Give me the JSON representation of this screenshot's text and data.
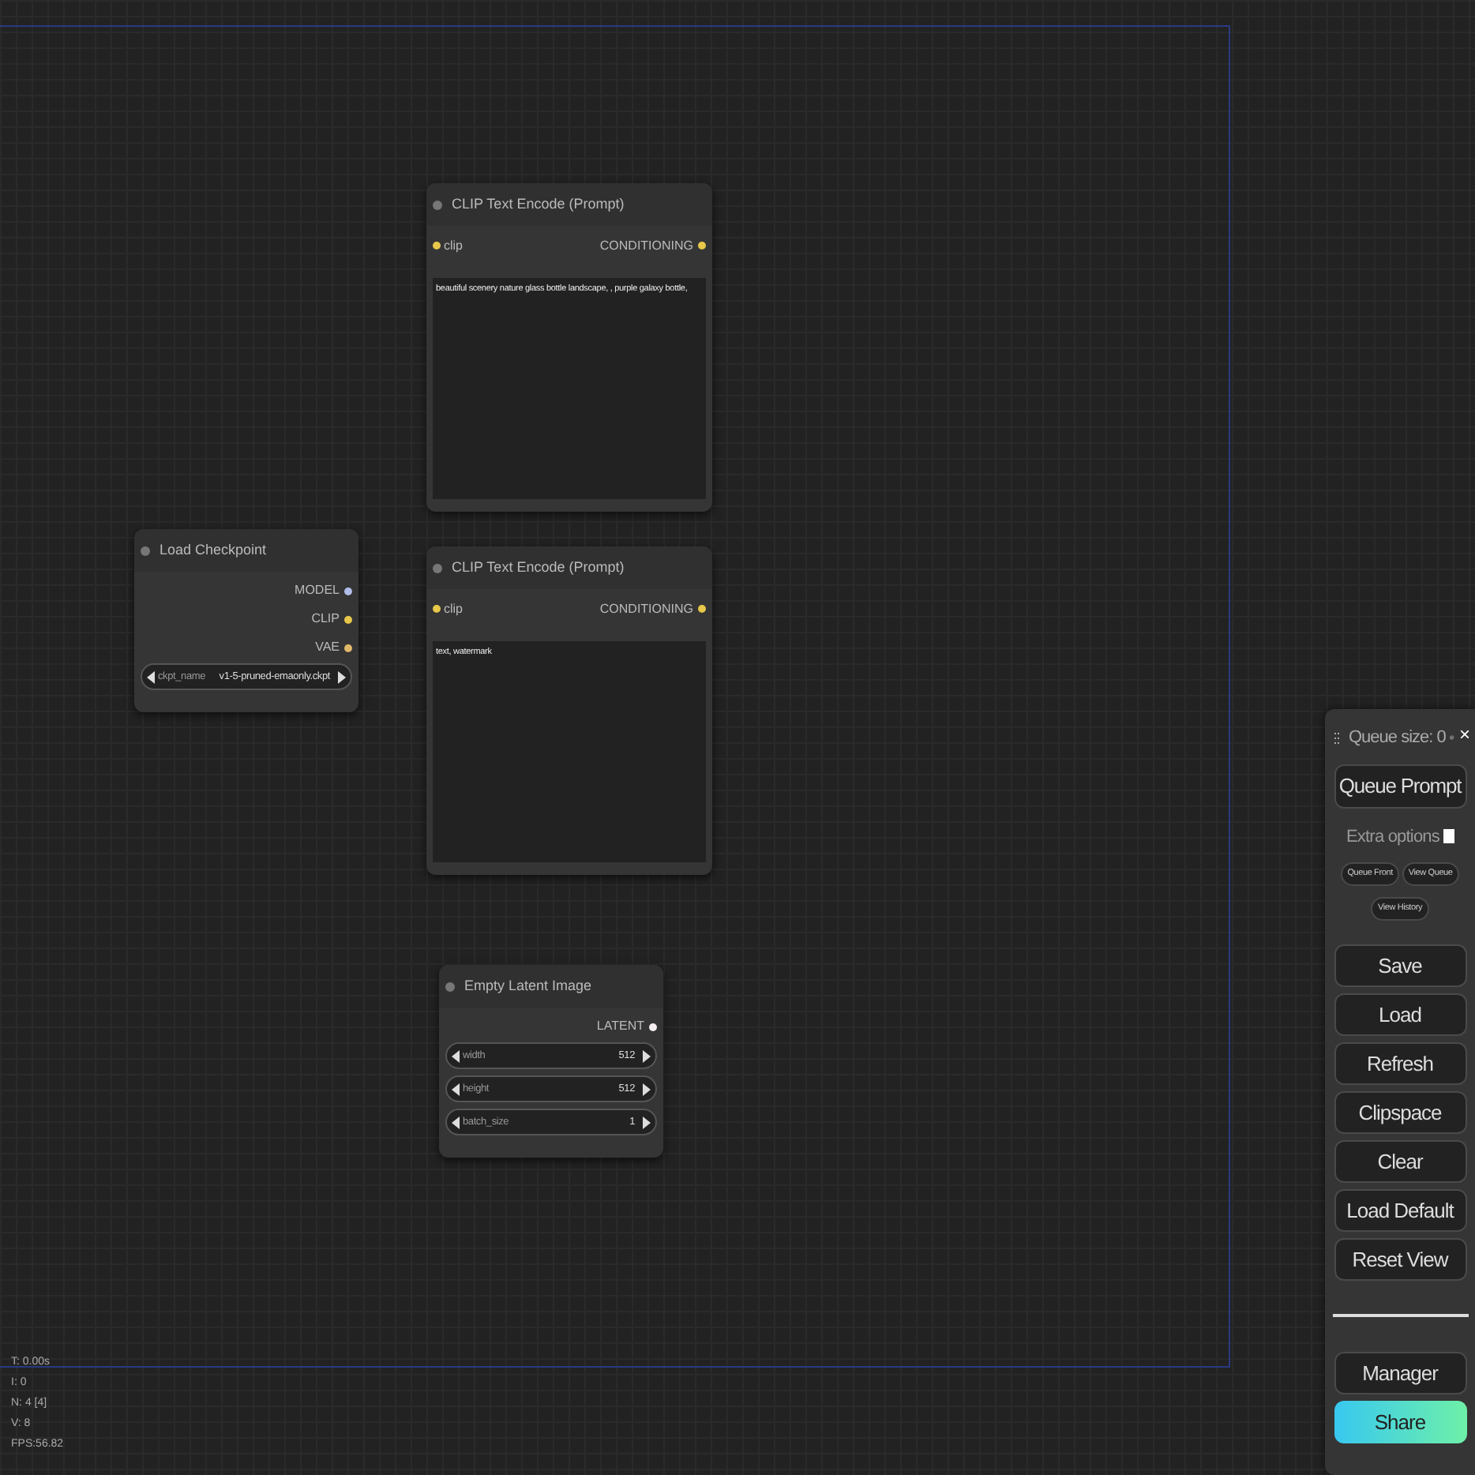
{
  "nodes": [
    {
      "kind": "checkpoint",
      "title": "Load Checkpoint",
      "outputs": [
        {
          "label": "MODEL",
          "color": "#b0bde8"
        },
        {
          "label": "CLIP",
          "color": "#e8c84a"
        },
        {
          "label": "VAE",
          "color": "#e0b86a"
        }
      ],
      "widgets": [
        {
          "name": "ckpt_name",
          "value": "v1-5-pruned-emaonly.ckpt"
        }
      ]
    },
    {
      "kind": "text_encode",
      "title": "CLIP Text Encode (Prompt)",
      "inputs": [
        {
          "label": "clip",
          "color": "#e8c84a"
        }
      ],
      "outputs": [
        {
          "label": "CONDITIONING",
          "color": "#e8c84a"
        }
      ],
      "text": "beautiful scenery nature glass bottle landscape, , purple galaxy bottle,"
    },
    {
      "kind": "text_encode",
      "title": "CLIP Text Encode (Prompt)",
      "inputs": [
        {
          "label": "clip",
          "color": "#e8c84a"
        }
      ],
      "outputs": [
        {
          "label": "CONDITIONING",
          "color": "#e8c84a"
        }
      ],
      "text": "text, watermark"
    },
    {
      "kind": "latent",
      "title": "Empty Latent Image",
      "outputs": [
        {
          "label": "LATENT",
          "color": "#f4eef0"
        }
      ],
      "widgets": [
        {
          "name": "width",
          "value": "512"
        },
        {
          "name": "height",
          "value": "512"
        },
        {
          "name": "batch_size",
          "value": "1"
        }
      ]
    }
  ],
  "stats": [
    "T: 0.00s",
    "I: 0",
    "N: 4 [4]",
    "V: 8",
    "FPS:56.82"
  ],
  "panel": {
    "queue_size": "Queue size: 0",
    "close": "×",
    "queue_button": "Queue Prompt",
    "extra_options": {
      "label": "Extra options",
      "checked": false
    },
    "small_buttons": [
      "Queue Front",
      "View Queue",
      "View History"
    ],
    "buttons": [
      "Save",
      "Load",
      "Refresh",
      "Clipspace",
      "Clear",
      "Load Default",
      "Reset View"
    ],
    "bottom_buttons": [
      {
        "label": "Manager",
        "kind": "plain"
      },
      {
        "label": "Share",
        "kind": "gradient"
      }
    ]
  }
}
